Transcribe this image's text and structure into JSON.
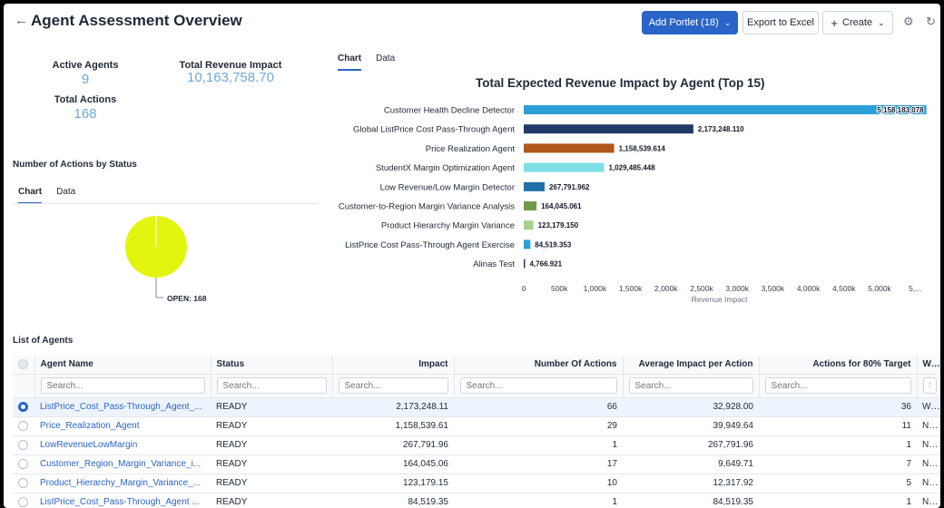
{
  "header": {
    "back_icon": "←",
    "title": "Agent Assessment Overview",
    "add_portlet": "Add Portlet (18)",
    "export": "Export to Excel",
    "create": "Create"
  },
  "kpis": {
    "active_agents_label": "Active Agents",
    "active_agents_value": "9",
    "revenue_label": "Total Revenue Impact",
    "revenue_value": "10,163,758.70",
    "actions_label": "Total Actions",
    "actions_value": "168"
  },
  "status_section": {
    "title": "Number of Actions by Status",
    "tabs": [
      "Chart",
      "Data"
    ],
    "pie_label": "OPEN: 168",
    "pie_color": "#e2f50f"
  },
  "revenue_section": {
    "tabs": [
      "Chart",
      "Data"
    ]
  },
  "chart_data": {
    "type": "bar",
    "orientation": "horizontal",
    "title": "Total Expected Revenue Impact by Agent (Top 15)",
    "xlabel": "Revenue Impact",
    "categories": [
      "Customer Health Decline Detector",
      "Global ListPrice Cost Pass-Through Agent",
      "Price Realization Agent",
      "StudentX Margin Optimization Agent",
      "Low Revenue/Low Margin Detector",
      "Customer-to-Region Margin Variance Analysis",
      "Product Hierarchy Margin Variance",
      "ListPrice Cost Pass-Through Agent Exercise",
      "Alinas Test"
    ],
    "values": [
      5158183078,
      2173248110,
      1158539614,
      1029485448,
      267791962,
      164045061,
      123179150,
      84519353,
      4766921
    ],
    "value_labels": [
      "5,158,183,078",
      "2,173,248.110",
      "1,158,539.614",
      "1,029,485.448",
      "267,791.962",
      "164,045.061",
      "123,179.150",
      "84,519.353",
      "4,766.921"
    ],
    "colors": [
      "#2b9fd8",
      "#243a6b",
      "#b1561a",
      "#7ee0e6",
      "#1f6fa8",
      "#6f9a4c",
      "#a8cf8c",
      "#2b9fd8",
      "#243a6b"
    ],
    "xticks": [
      "0",
      "500k",
      "1,000k",
      "1,500k",
      "2,000k",
      "2,500k",
      "3,000k",
      "3,500k",
      "4,000k",
      "4,500k",
      "5,000k",
      "5,..."
    ],
    "xlim": [
      0,
      5000000000
    ]
  },
  "agents_table": {
    "title": "List of Agents",
    "search_placeholder": "Search...",
    "columns": [
      "Agent Name",
      "Status",
      "Impact",
      "Number Of Actions",
      "Average Impact per Action",
      "Actions for 80% Target",
      "Work"
    ],
    "rows": [
      [
        "ListPrice_Cost_Pass-Through_Agent_...",
        "READY",
        "2,173,248.11",
        "66",
        "32,928.00",
        "36",
        "WITH"
      ],
      [
        "Price_Realization_Agent",
        "READY",
        "1,158,539.61",
        "29",
        "39,949.64",
        "11",
        "NO_A"
      ],
      [
        "LowRevenueLowMargin",
        "READY",
        "267,791.96",
        "1",
        "267,791.96",
        "1",
        "NO_A"
      ],
      [
        "Customer_Region_Margin_Variance_i...",
        "READY",
        "164,045.06",
        "17",
        "9,649.71",
        "7",
        "NO_A"
      ],
      [
        "Product_Hierarchy_Margin_Variance_...",
        "READY",
        "123,179.15",
        "10",
        "12,317.92",
        "5",
        "NO_A"
      ],
      [
        "ListPrice_Cost_Pass-Through_Agent ...",
        "READY",
        "84,519.35",
        "1",
        "84,519.35",
        "1",
        "NO_A"
      ]
    ],
    "selected_row": 0
  }
}
